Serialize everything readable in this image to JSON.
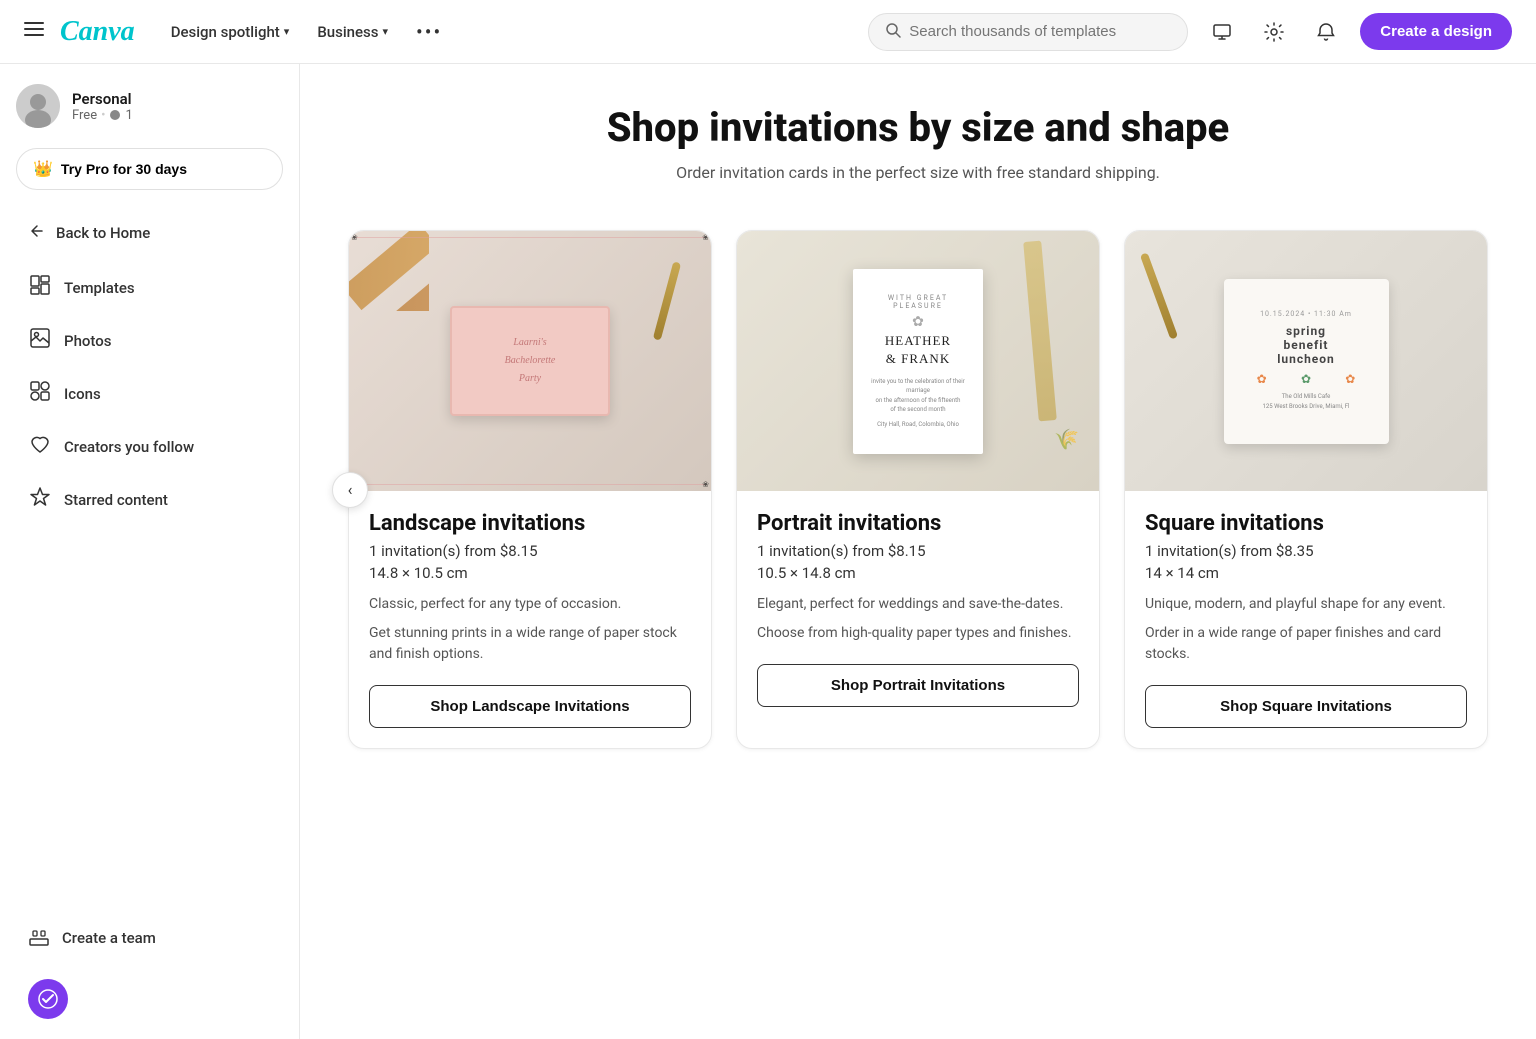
{
  "nav": {
    "logo": "Canva",
    "menu": [
      {
        "label": "Design spotlight",
        "id": "design-spotlight"
      },
      {
        "label": "Business",
        "id": "business"
      }
    ],
    "more": "•••",
    "search_placeholder": "Search thousands of templates",
    "create_button": "Create a design"
  },
  "sidebar": {
    "profile": {
      "name": "Personal",
      "plan": "Free",
      "connections": "1"
    },
    "pro_button": "Try Pro for 30 days",
    "back_label": "Back to Home",
    "nav_items": [
      {
        "id": "templates",
        "label": "Templates"
      },
      {
        "id": "photos",
        "label": "Photos"
      },
      {
        "id": "icons",
        "label": "Icons"
      },
      {
        "id": "creators",
        "label": "Creators you follow"
      },
      {
        "id": "starred",
        "label": "Starred content"
      }
    ],
    "team_label": "Create a team"
  },
  "main": {
    "title": "Shop invitations by size and shape",
    "subtitle": "Order invitation cards in the perfect size with free standard shipping.",
    "cards": [
      {
        "id": "landscape",
        "title": "Landscape invitations",
        "price": "1 invitation(s) from $8.15",
        "size": "14.8 × 10.5 cm",
        "desc": "Classic, perfect for any type of occasion.",
        "desc2": "Get stunning prints in a wide range of paper stock and finish options.",
        "button": "Shop Landscape Invitations",
        "image_alt": "Landscape invitation card"
      },
      {
        "id": "portrait",
        "title": "Portrait invitations",
        "price": "1 invitation(s) from $8.15",
        "size": "10.5 × 14.8 cm",
        "desc": "Elegant, perfect for weddings and save-the-dates.",
        "desc2": "Choose from high-quality paper types and finishes.",
        "button": "Shop Portrait Invitations",
        "image_alt": "Portrait invitation card"
      },
      {
        "id": "square",
        "title": "Square invitations",
        "price": "1 invitation(s) from $8.35",
        "size": "14 × 14 cm",
        "desc": "Unique, modern, and playful shape for any event.",
        "desc2": "Order in a wide range of paper finishes and card stocks.",
        "button": "Shop Square Invitations",
        "image_alt": "Square invitation card"
      }
    ]
  },
  "colors": {
    "accent": "#7c3aed",
    "pro_gold": "#f5a623"
  }
}
